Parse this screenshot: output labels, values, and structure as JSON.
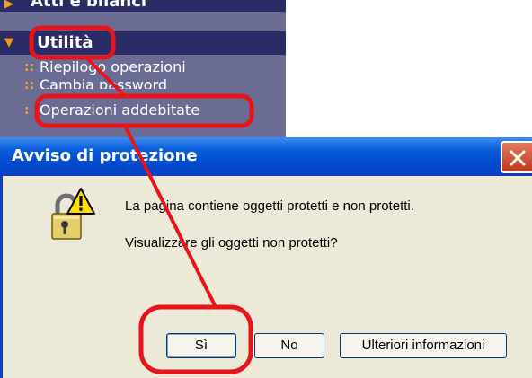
{
  "nav": {
    "section_prev": "Atti e bilanci",
    "section_current": "Utilità",
    "links": [
      {
        "dots": "::",
        "label": "Riepilogo operazioni"
      },
      {
        "dots": "::",
        "label": "Cambia password"
      },
      {
        "dots": ":",
        "label": "Operazioni addebitate"
      }
    ]
  },
  "dialog": {
    "title": "Avviso di protezione",
    "message_1": "La pagina contiene oggetti protetti e non protetti.",
    "message_2": "Visualizzare gli oggetti non protetti?",
    "buttons": {
      "yes": "Sì",
      "no": "No",
      "more_info": "Ulteriori informazioni"
    },
    "icon": "lock-warning-icon",
    "close_icon": "close-icon"
  },
  "colors": {
    "nav_bg": "#6a6c94",
    "nav_header_bg": "#2b2c66",
    "accent_orange": "#f0a11b",
    "titlebar_blue": "#0a5fdb",
    "dialog_bg": "#ece9d8",
    "annotation_red": "#e8141a"
  }
}
